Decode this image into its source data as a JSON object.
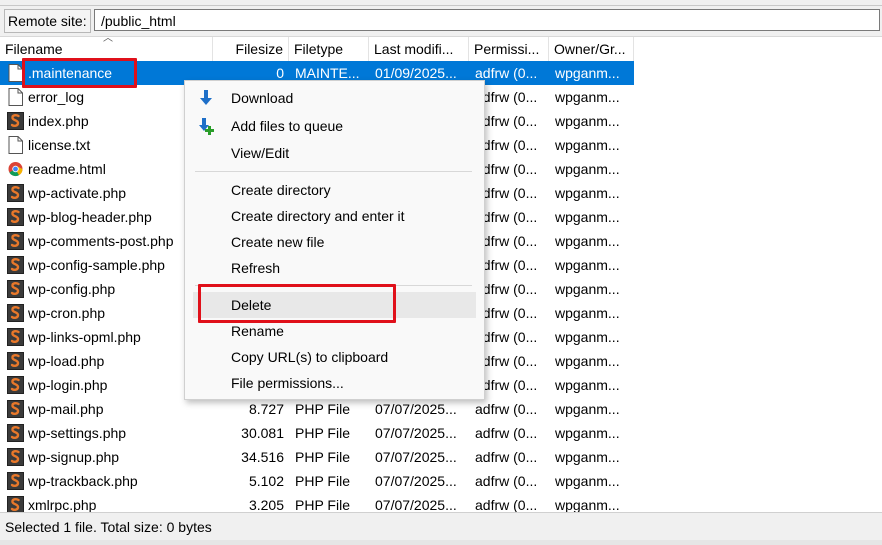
{
  "remote": {
    "label": "Remote site:",
    "path": "/public_html"
  },
  "columns": {
    "filename": "Filename",
    "filesize": "Filesize",
    "filetype": "Filetype",
    "modified": "Last modifi...",
    "permissions": "Permissi...",
    "owner": "Owner/Gr..."
  },
  "files": [
    {
      "name": ".maintenance",
      "size": "0",
      "type": "MAINTE...",
      "modified": "01/09/2025...",
      "perm": "adfrw (0...",
      "owner": "wpganm...",
      "icon": "blank-file-icon",
      "selected": true
    },
    {
      "name": "error_log",
      "size": "",
      "type": "",
      "modified": "",
      "perm": "adfrw (0...",
      "owner": "wpganm...",
      "icon": "blank-file-icon"
    },
    {
      "name": "index.php",
      "size": "",
      "type": "",
      "modified": "",
      "perm": "adfrw (0...",
      "owner": "wpganm...",
      "icon": "php-file-icon"
    },
    {
      "name": "license.txt",
      "size": "",
      "type": "",
      "modified": "",
      "perm": "adfrw (0...",
      "owner": "wpganm...",
      "icon": "text-file-icon"
    },
    {
      "name": "readme.html",
      "size": "",
      "type": "",
      "modified": "",
      "perm": "adfrw (0...",
      "owner": "wpganm...",
      "icon": "chrome-html-icon"
    },
    {
      "name": "wp-activate.php",
      "size": "",
      "type": "",
      "modified": "",
      "perm": "adfrw (0...",
      "owner": "wpganm...",
      "icon": "php-file-icon"
    },
    {
      "name": "wp-blog-header.php",
      "size": "",
      "type": "",
      "modified": "",
      "perm": "adfrw (0...",
      "owner": "wpganm...",
      "icon": "php-file-icon"
    },
    {
      "name": "wp-comments-post.php",
      "size": "",
      "type": "",
      "modified": "",
      "perm": "adfrw (0...",
      "owner": "wpganm...",
      "icon": "php-file-icon"
    },
    {
      "name": "wp-config-sample.php",
      "size": "",
      "type": "",
      "modified": "",
      "perm": "adfrw (0...",
      "owner": "wpganm...",
      "icon": "php-file-icon"
    },
    {
      "name": "wp-config.php",
      "size": "",
      "type": "",
      "modified": "",
      "perm": "adfrw (0...",
      "owner": "wpganm...",
      "icon": "php-file-icon"
    },
    {
      "name": "wp-cron.php",
      "size": "",
      "type": "",
      "modified": "",
      "perm": "adfrw (0...",
      "owner": "wpganm...",
      "icon": "php-file-icon"
    },
    {
      "name": "wp-links-opml.php",
      "size": "",
      "type": "",
      "modified": "",
      "perm": "adfrw (0...",
      "owner": "wpganm...",
      "icon": "php-file-icon"
    },
    {
      "name": "wp-load.php",
      "size": "",
      "type": "",
      "modified": "",
      "perm": "adfrw (0...",
      "owner": "wpganm...",
      "icon": "php-file-icon"
    },
    {
      "name": "wp-login.php",
      "size": "",
      "type": "",
      "modified": "",
      "perm": "adfrw (0...",
      "owner": "wpganm...",
      "icon": "php-file-icon"
    },
    {
      "name": "wp-mail.php",
      "size": "8.727",
      "type": "PHP File",
      "modified": "07/07/2025...",
      "perm": "adfrw (0...",
      "owner": "wpganm...",
      "icon": "php-file-icon"
    },
    {
      "name": "wp-settings.php",
      "size": "30.081",
      "type": "PHP File",
      "modified": "07/07/2025...",
      "perm": "adfrw (0...",
      "owner": "wpganm...",
      "icon": "php-file-icon"
    },
    {
      "name": "wp-signup.php",
      "size": "34.516",
      "type": "PHP File",
      "modified": "07/07/2025...",
      "perm": "adfrw (0...",
      "owner": "wpganm...",
      "icon": "php-file-icon"
    },
    {
      "name": "wp-trackback.php",
      "size": "5.102",
      "type": "PHP File",
      "modified": "07/07/2025...",
      "perm": "adfrw (0...",
      "owner": "wpganm...",
      "icon": "php-file-icon"
    },
    {
      "name": "xmlrpc.php",
      "size": "3.205",
      "type": "PHP File",
      "modified": "07/07/2025...",
      "perm": "adfrw (0...",
      "owner": "wpganm...",
      "icon": "php-file-icon"
    }
  ],
  "context_menu": {
    "download": "Download",
    "add_to_queue": "Add files to queue",
    "view_edit": "View/Edit",
    "create_dir": "Create directory",
    "create_dir_enter": "Create directory and enter it",
    "create_file": "Create new file",
    "refresh": "Refresh",
    "delete": "Delete",
    "rename": "Rename",
    "copy_url": "Copy URL(s) to clipboard",
    "file_permissions": "File permissions..."
  },
  "status": "Selected 1 file. Total size: 0 bytes",
  "colors": {
    "selection": "#0078d7",
    "highlight": "#e0101a",
    "php_icon": "#e8782a"
  }
}
